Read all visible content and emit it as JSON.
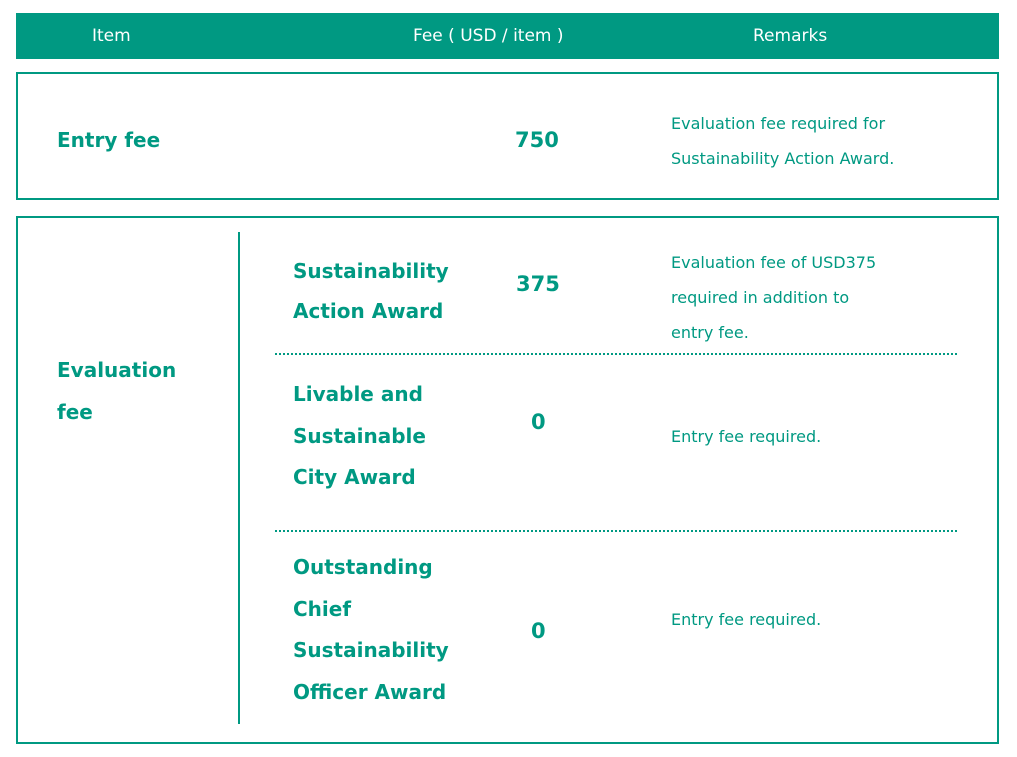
{
  "header": {
    "item": "Item",
    "fee": "Fee ( USD / item )",
    "remarks": "Remarks"
  },
  "entry": {
    "label": "Entry fee",
    "fee": "750",
    "remark_lines": [
      "Evaluation fee required for",
      "Sustainability Action Award."
    ]
  },
  "evaluation": {
    "label_lines": [
      "Evaluation",
      "fee"
    ],
    "awards": [
      {
        "name_lines": [
          "Sustainability",
          "Action Award"
        ],
        "fee": "375",
        "remark_lines": [
          "Evaluation fee of USD375",
          "required in addition to",
          "entry fee."
        ]
      },
      {
        "name_lines": [
          "Livable and",
          "Sustainable",
          "City Award"
        ],
        "fee": "0",
        "remark_lines": [
          "Entry fee required."
        ]
      },
      {
        "name_lines": [
          "Outstanding",
          "Chief",
          "Sustainability",
          "Officer Award"
        ],
        "fee": "0",
        "remark_lines": [
          "Entry fee required."
        ]
      }
    ]
  },
  "colors": {
    "accent": "#009982",
    "header_text": "#ffffff"
  }
}
